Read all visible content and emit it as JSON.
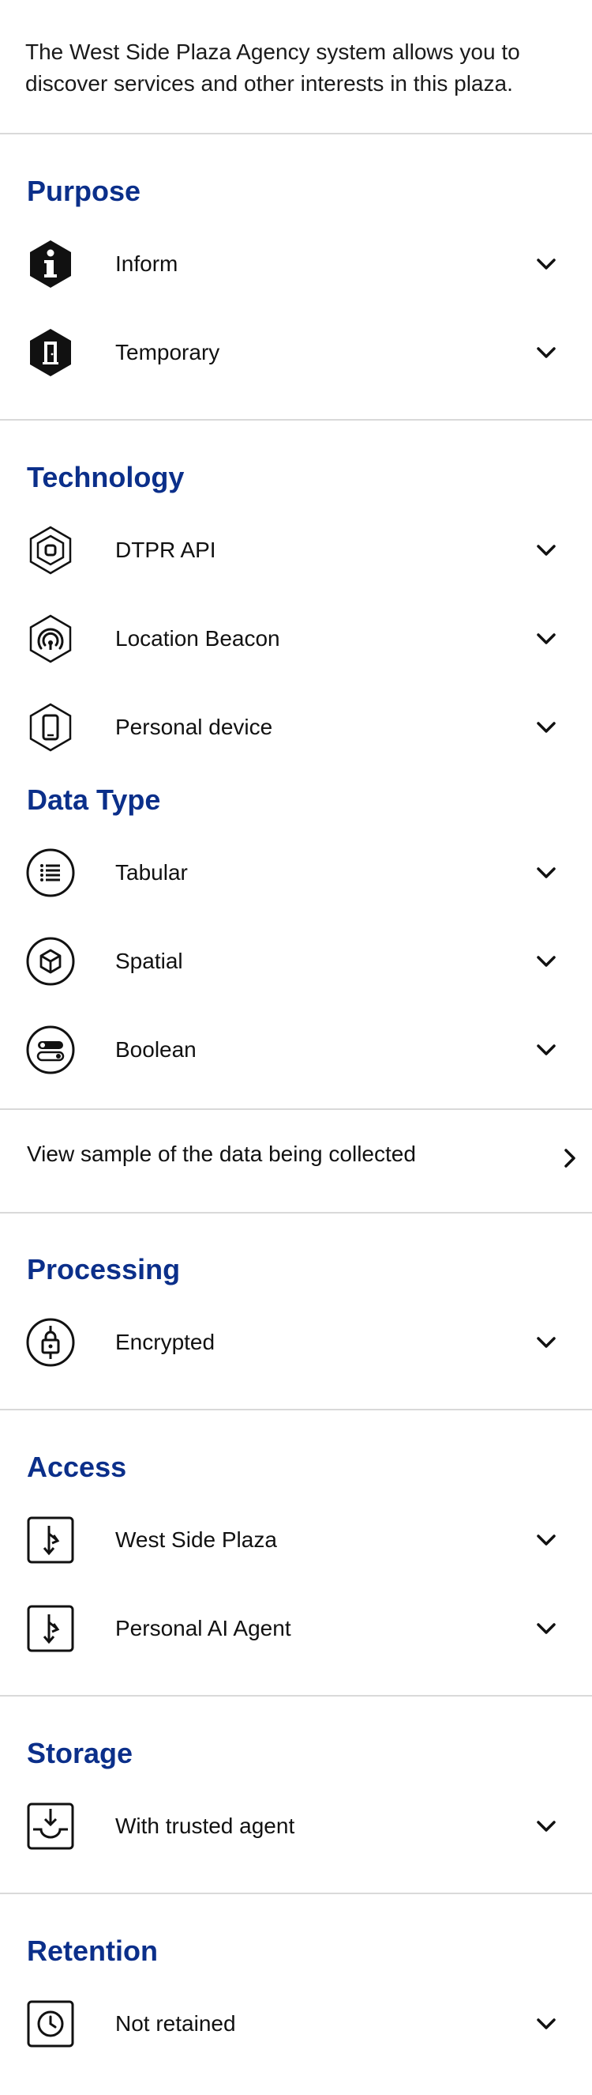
{
  "intro": "The West Side Plaza Agency system allows you to discover services and other interests in this plaza.",
  "sections": {
    "purpose": {
      "heading": "Purpose",
      "items": [
        {
          "label": "Inform",
          "icon": "info-hexagon-icon"
        },
        {
          "label": "Temporary",
          "icon": "door-hexagon-icon"
        }
      ]
    },
    "technology": {
      "heading": "Technology",
      "items": [
        {
          "label": "DTPR API",
          "icon": "api-hexagon-icon"
        },
        {
          "label": "Location Beacon",
          "icon": "beacon-hexagon-icon"
        },
        {
          "label": "Personal device",
          "icon": "phone-hexagon-icon"
        }
      ]
    },
    "data_type": {
      "heading": "Data Type",
      "items": [
        {
          "label": "Tabular",
          "icon": "list-circle-icon"
        },
        {
          "label": "Spatial",
          "icon": "cube-circle-icon"
        },
        {
          "label": "Boolean",
          "icon": "toggle-circle-icon"
        }
      ]
    },
    "sample_link": {
      "label": "View sample of the data being collected",
      "icon": "chevron-right-icon"
    },
    "processing": {
      "heading": "Processing",
      "items": [
        {
          "label": "Encrypted",
          "icon": "lock-circle-icon"
        }
      ]
    },
    "access": {
      "heading": "Access",
      "items": [
        {
          "label": "West Side Plaza",
          "icon": "access-square-icon"
        },
        {
          "label": "Personal AI Agent",
          "icon": "access-square-icon"
        }
      ]
    },
    "storage": {
      "heading": "Storage",
      "items": [
        {
          "label": "With trusted agent",
          "icon": "inbox-square-icon"
        }
      ]
    },
    "retention": {
      "heading": "Retention",
      "items": [
        {
          "label": "Not retained",
          "icon": "clock-square-icon"
        }
      ]
    }
  },
  "colors": {
    "heading": "#0b2f8a",
    "divider": "#d9d9d9",
    "text": "#111111"
  }
}
